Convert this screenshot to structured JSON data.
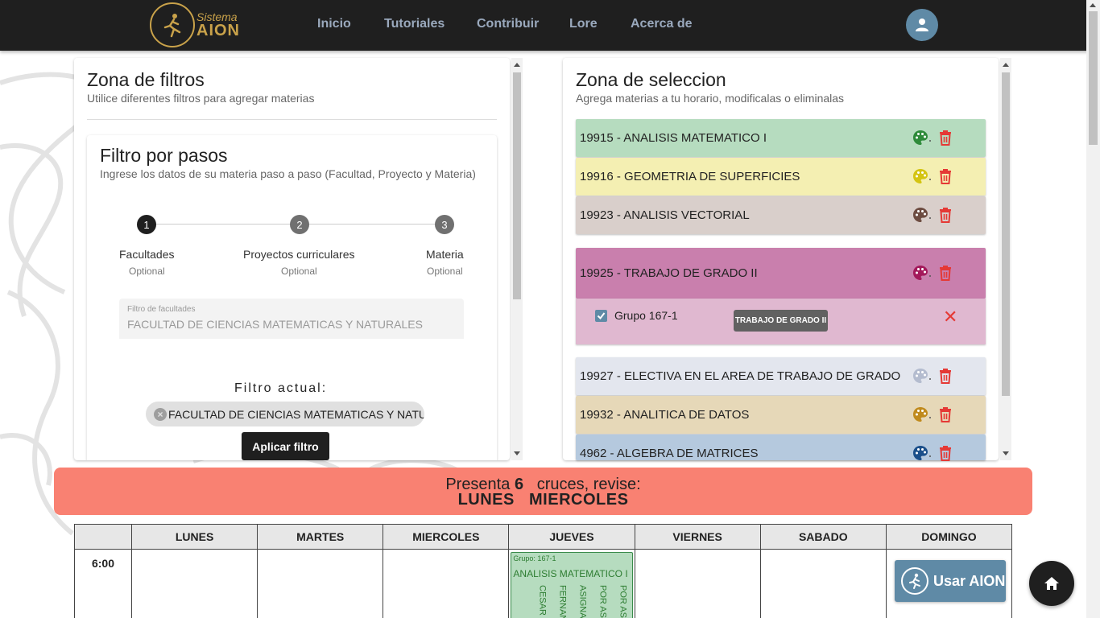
{
  "nav": {
    "logo_line1": "Sistema",
    "logo_line2": "AION",
    "items": [
      "Inicio",
      "Tutoriales",
      "Contribuir",
      "Lore",
      "Acerca de"
    ]
  },
  "filters": {
    "title": "Zona de filtros",
    "subtitle": "Utilice diferentes filtros para agregar materias",
    "card_title": "Filtro por pasos",
    "card_subtitle": "Ingrese los datos de su materia paso a paso (Facultad, Proyecto y Materia)",
    "steps": [
      {
        "num": "1",
        "label": "Facultades",
        "optional": "Optional"
      },
      {
        "num": "2",
        "label": "Proyectos curriculares",
        "optional": "Optional"
      },
      {
        "num": "3",
        "label": "Materia",
        "optional": "Optional"
      }
    ],
    "field_label": "Filtro de facultades",
    "field_value": "FACULTAD DE CIENCIAS MATEMATICAS Y NATURALES",
    "current_label": "Filtro actual:",
    "chip": "FACULTAD DE CIENCIAS MATEMATICAS Y NATURALES",
    "apply_button": "Aplicar filtro"
  },
  "selection": {
    "title": "Zona de seleccion",
    "subtitle": "Agrega materias a tu horario, modificalas o eliminalas",
    "subjects": [
      {
        "name": "19915 - ANALISIS MATEMATICO I",
        "bg": "#b6dcbf",
        "palette": "#2e8b3a"
      },
      {
        "name": "19916 - GEOMETRIA DE SUPERFICIES",
        "bg": "#f4efb2",
        "palette": "#d4c411"
      },
      {
        "name": "19923 - ANALISIS VECTORIAL",
        "bg": "#d9cfcb",
        "palette": "#6d4c41"
      },
      {
        "name": "19925 - TRABAJO DE GRADO II",
        "bg": "#c97fad",
        "palette": "#a3195b"
      },
      {
        "name": "19927 - ELECTIVA EN EL AREA DE TRABAJO DE GRADO",
        "bg": "#e3e6ee",
        "palette": "#b4bccf"
      },
      {
        "name": "19932 - ANALITICA DE DATOS",
        "bg": "#e6d8b8",
        "palette": "#c08a1c"
      },
      {
        "name": "4962 - ALGEBRA DE MATRICES",
        "bg": "#b5c9de",
        "palette": "#1b4f8a"
      }
    ],
    "group_label": "Grupo 167-1",
    "tooltip": "TRABAJO DE GRADO II"
  },
  "banner": {
    "prefix": "Presenta",
    "count": "6",
    "suffix": "cruces, revise:",
    "days": "LUNES   MIERCOLES"
  },
  "schedule": {
    "days": [
      "LUNES",
      "MARTES",
      "MIERCOLES",
      "JUEVES",
      "VIERNES",
      "SABADO",
      "DOMINGO"
    ],
    "time": "6:00",
    "block_group": "Grupo: 167-1",
    "block_name": "ANALISIS MATEMATICO I",
    "block_lines": [
      "POR AS",
      "POR ASI",
      "ASIGNA",
      "FERNAN",
      "CESAR"
    ]
  },
  "buttons": {
    "usar": "Usar AION"
  },
  "icons": {
    "palette": "palette-icon",
    "trash": "trash-icon",
    "home": "home-icon",
    "user": "user-icon"
  }
}
